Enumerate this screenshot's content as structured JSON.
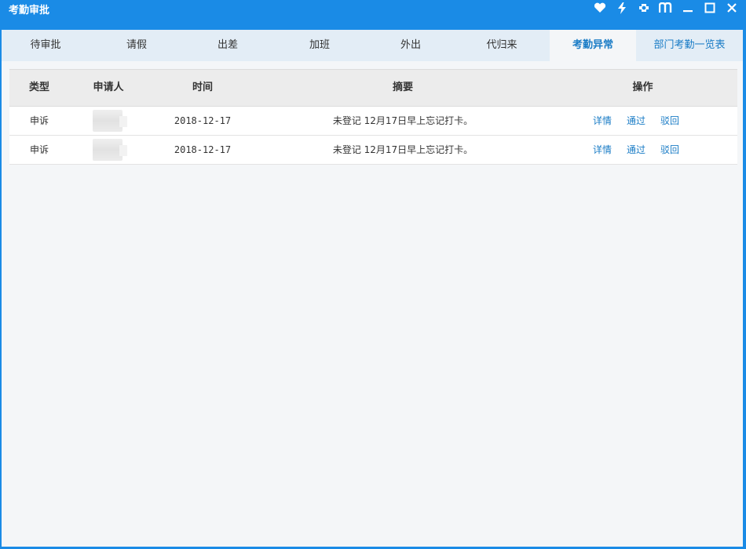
{
  "window": {
    "title": "考勤审批",
    "controls": [
      "heart-icon",
      "lightning-icon",
      "skin-icon",
      "book-icon",
      "minimize-icon",
      "maximize-icon",
      "close-icon"
    ]
  },
  "tabs": [
    {
      "label": "待审批",
      "active": false
    },
    {
      "label": "请假",
      "active": false
    },
    {
      "label": "出差",
      "active": false
    },
    {
      "label": "加班",
      "active": false
    },
    {
      "label": "外出",
      "active": false
    },
    {
      "label": "代归来",
      "active": false
    },
    {
      "label": "考勤异常",
      "active": true
    },
    {
      "label": "部门考勤一览表",
      "active": false
    }
  ],
  "table": {
    "headers": {
      "type": "类型",
      "applicant": "申请人",
      "time": "时间",
      "summary": "摘要",
      "action": "操作"
    },
    "rows": [
      {
        "type": "申诉",
        "applicant": "",
        "time": "2018-12-17",
        "summary": "未登记 12月17日早上忘记打卡。",
        "actions": {
          "detail": "详情",
          "approve": "通过",
          "reject": "驳回"
        }
      },
      {
        "type": "申诉",
        "applicant": "",
        "time": "2018-12-17",
        "summary": "未登记 12月17日早上忘记打卡。",
        "actions": {
          "detail": "详情",
          "approve": "通过",
          "reject": "驳回"
        }
      }
    ]
  },
  "colors": {
    "titlebar": "#1a8be6",
    "accent": "#1a7cc6",
    "content_bg": "#f4f6f8",
    "tabbar_bg": "#e3edf6"
  }
}
